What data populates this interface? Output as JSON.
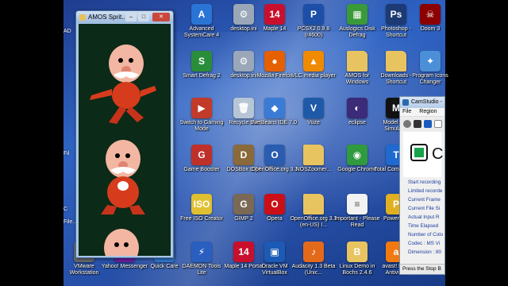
{
  "amos_window": {
    "title": "AMOS Sprit..."
  },
  "camstudio": {
    "title": "CamStudio -",
    "menu": [
      "File",
      "Region"
    ],
    "stats": [
      "Start recording",
      "Limited recorde",
      "Current Frame",
      "Current File Si",
      "Actual Input R",
      "Time Elapsed",
      "Number of Colo",
      "Codec : MS Vi",
      "Dimension : 80"
    ],
    "status": "Press the Stop B"
  },
  "left_clipped": [
    "AD",
    "Fil",
    "C",
    "File..."
  ],
  "icons": [
    {
      "label": "Advanced SystemCare 4",
      "icon": "asc-icon",
      "color": "#2a74d6",
      "glyph": "A"
    },
    {
      "label": "desktop.ini",
      "icon": "gear-file-icon",
      "color": "#9aa7b8",
      "glyph": "⚙"
    },
    {
      "label": "Maple 14",
      "icon": "maple-icon",
      "color": "#c8102e",
      "glyph": "14"
    },
    {
      "label": "PCSX2 0.9.8 (r4600)",
      "icon": "pcsx2-icon",
      "color": "#1d4fa8",
      "glyph": "P"
    },
    {
      "label": "Auslogics Disk Defrag",
      "icon": "defrag-icon",
      "color": "#3a9a3a",
      "glyph": "▦"
    },
    {
      "label": "Photoshop - Shortcut",
      "icon": "photoshop-icon",
      "color": "#1c3a73",
      "glyph": "Ps"
    },
    {
      "label": "Doom 3",
      "icon": "doom-icon",
      "color": "#8b0000",
      "glyph": "☠"
    },
    {
      "label": "Smart Defrag 2",
      "icon": "smart-defrag-icon",
      "color": "#2a8d3a",
      "glyph": "S"
    },
    {
      "label": "desktop.ini",
      "icon": "gear-file-icon",
      "color": "#9aa7b8",
      "glyph": "⚙"
    },
    {
      "label": "Mozilla Firefox",
      "icon": "firefox-icon",
      "color": "#e66000",
      "glyph": "●"
    },
    {
      "label": "VLC media player",
      "icon": "vlc-icon",
      "color": "#f08a00",
      "glyph": "▲"
    },
    {
      "label": "AMOS for Windows",
      "icon": "folder-icon",
      "color": "#e8c460",
      "glyph": ""
    },
    {
      "label": "Downloads - Shortcut",
      "icon": "folder-icon",
      "color": "#e8c460",
      "glyph": ""
    },
    {
      "label": "Program Icons Changer",
      "icon": "icon-changer-icon",
      "color": "#4a8fd8",
      "glyph": "✦"
    },
    {
      "label": "Switch to Gaming Mode",
      "icon": "gaming-mode-icon",
      "color": "#c23a2a",
      "glyph": "▶"
    },
    {
      "label": "Recycle Bin",
      "icon": "recycle-bin-icon",
      "color": "#b7c6d6",
      "glyph": "🗑"
    },
    {
      "label": "NetBeans IDE 7.0",
      "icon": "netbeans-icon",
      "color": "#3a7bd5",
      "glyph": "◆"
    },
    {
      "label": "Vuze",
      "icon": "vuze-icon",
      "color": "#1e5aa8",
      "glyph": "V"
    },
    {
      "label": "eclipse",
      "icon": "eclipse-icon",
      "color": "#3b2b78",
      "glyph": "◐"
    },
    {
      "label": "Model Sim Simulator",
      "icon": "modelsim-icon",
      "color": "#111111",
      "glyph": "M"
    },
    {
      "label": "Game Booster",
      "icon": "game-booster-icon",
      "color": "#c0302a",
      "glyph": "G"
    },
    {
      "label": "DOSBox 0.74",
      "icon": "dosbox-icon",
      "color": "#8a6a3a",
      "glyph": "D"
    },
    {
      "label": "OpenOffice.org 3.3",
      "icon": "openoffice-icon",
      "color": "#2a5db0",
      "glyph": "O"
    },
    {
      "label": "NOSZoomer...",
      "icon": "folder-icon",
      "color": "#e8c460",
      "glyph": ""
    },
    {
      "label": "Google Chrome",
      "icon": "chrome-icon",
      "color": "#2f9b3e",
      "glyph": "◉"
    },
    {
      "label": "Total Commander",
      "icon": "total-commander-icon",
      "color": "#1e6ad0",
      "glyph": "T"
    },
    {
      "label": "Free ISO Creator",
      "icon": "iso-creator-icon",
      "color": "#e0c030",
      "glyph": "ISO"
    },
    {
      "label": "GIMP 2",
      "icon": "gimp-icon",
      "color": "#7a6a55",
      "glyph": "G"
    },
    {
      "label": "Opera",
      "icon": "opera-icon",
      "color": "#cc0f16",
      "glyph": "O"
    },
    {
      "label": "OpenOffice.org 3.3 (en-US) I...",
      "icon": "folder-icon",
      "color": "#e8c460",
      "glyph": ""
    },
    {
      "label": "Important - Please Read",
      "icon": "text-file-icon",
      "color": "#f2f2f2",
      "glyph": "≡"
    },
    {
      "label": "PowerISO",
      "icon": "poweriso-icon",
      "color": "#e0b020",
      "glyph": "P"
    },
    {
      "label": "VMware Workstation",
      "icon": "vmware-icon",
      "color": "#6a6a6a",
      "glyph": "vm"
    },
    {
      "label": "Yahoo! Messenger",
      "icon": "yahoo-icon",
      "color": "#6b1fa0",
      "glyph": "Y!"
    },
    {
      "label": "Quick Care",
      "icon": "quick-care-icon",
      "color": "#2f7ad2",
      "glyph": "Q"
    },
    {
      "label": "DAEMON Tools Lite",
      "icon": "daemon-tools-icon",
      "color": "#2a5fc0",
      "glyph": "⚡"
    },
    {
      "label": "Maple 14 Portal",
      "icon": "maple-portal-icon",
      "color": "#c8102e",
      "glyph": "14"
    },
    {
      "label": "Oracle VM VirtualBox",
      "icon": "virtualbox-icon",
      "color": "#1b5bb5",
      "glyph": "▣"
    },
    {
      "label": "Audacity 1.3 Beta (Unic...",
      "icon": "audacity-icon",
      "color": "#e36a1a",
      "glyph": "♪"
    },
    {
      "label": "Linux Demo in Bochs 2.4.6",
      "icon": "bochs-icon",
      "color": "#e8c460",
      "glyph": "B"
    },
    {
      "label": "avast! Free Antivirus",
      "icon": "avast-icon",
      "color": "#f07a10",
      "glyph": "a"
    }
  ]
}
